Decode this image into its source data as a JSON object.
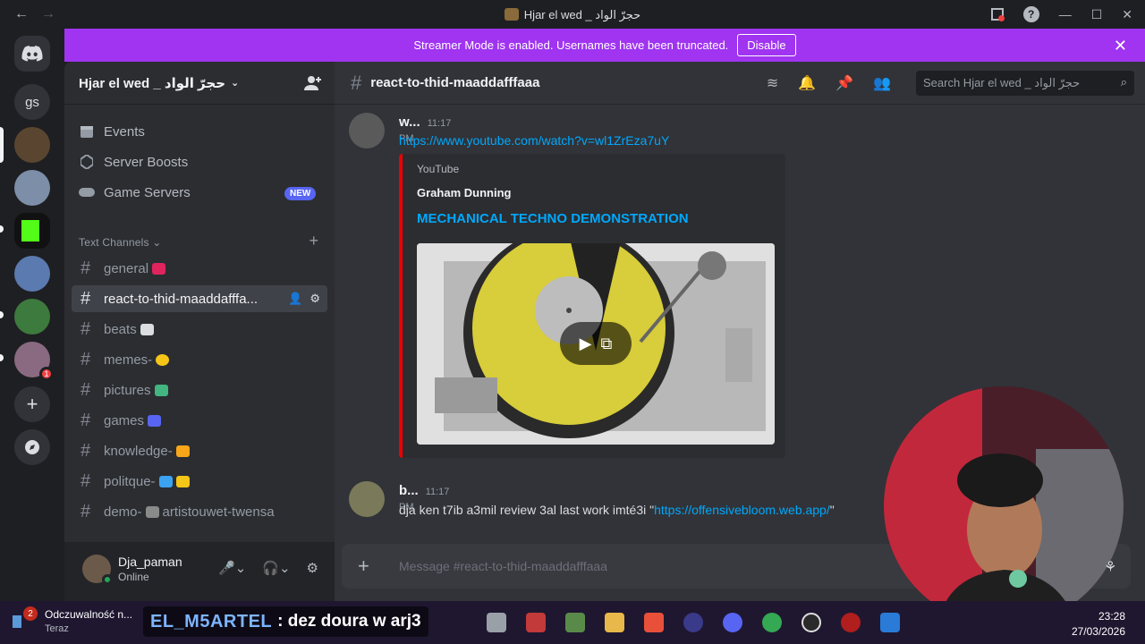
{
  "window": {
    "title": "Hjar el wed _ حجرّ الواد"
  },
  "banner": {
    "text": "Streamer Mode is enabled. Usernames have been truncated.",
    "button": "Disable"
  },
  "rail": {
    "gs_label": "gs",
    "notif_count": "1"
  },
  "guild": {
    "name": "Hjar el wed _ حجرّ الواد"
  },
  "menu": {
    "events": "Events",
    "boosts": "Server Boosts",
    "game_servers": "Game Servers",
    "new_badge": "NEW"
  },
  "category": "Text Channels",
  "channels": [
    {
      "name": "general",
      "emoji_color": "#e0245e"
    },
    {
      "name": "react-to-thid-maaddafffa...",
      "emoji_color": ""
    },
    {
      "name": "beats",
      "emoji_color": "#7289da"
    },
    {
      "name": "memes-",
      "emoji_color": "#f5c518"
    },
    {
      "name": "pictures",
      "emoji_color": "#43b581"
    },
    {
      "name": "games",
      "emoji_color": "#5865f2"
    },
    {
      "name": "knowledge-",
      "emoji_color": "#faa61a"
    },
    {
      "name": "politque-",
      "emoji_color": "#3ba3f0"
    },
    {
      "name": "demo-",
      "suffix": "artistouwet-twensa",
      "emoji_color": "#8a8a8a"
    }
  ],
  "user": {
    "name": "Dja_paman",
    "status": "Online"
  },
  "channel_header": {
    "name": "react-to-thid-maaddafffaaa",
    "search_placeholder": "Search Hjar el wed _ حجرّ الواد"
  },
  "messages": [
    {
      "author": "w...",
      "time": "11:17 PM",
      "link": "https://www.youtube.com/watch?v=wl1ZrEza7uY",
      "embed": {
        "provider": "YouTube",
        "author": "Graham Dunning",
        "title": "MECHANICAL TECHNO DEMONSTRATION"
      }
    },
    {
      "author": "b...",
      "time": "11:17 PM",
      "text": "dja ken t7ib a3mil review 3al last work imté3i \"",
      "link": "https://offensivebloom.web.app/",
      "tail": "\""
    }
  ],
  "composer": {
    "placeholder": "Message #react-to-thid-maaddafffaaa"
  },
  "taskbar": {
    "notif_title": "Odczuwalność n...",
    "notif_sub": "Teraz",
    "notif_count": "2",
    "overlay_user": "EL_M5ARTEL",
    "overlay_msg": ": dez doura w arj3",
    "time": "23:28",
    "date": "27/03/2026"
  },
  "colors": {
    "banner": "#a034f0",
    "accent": "#5865f2",
    "link": "#00a8fc",
    "embed_border": "#ee0000"
  }
}
